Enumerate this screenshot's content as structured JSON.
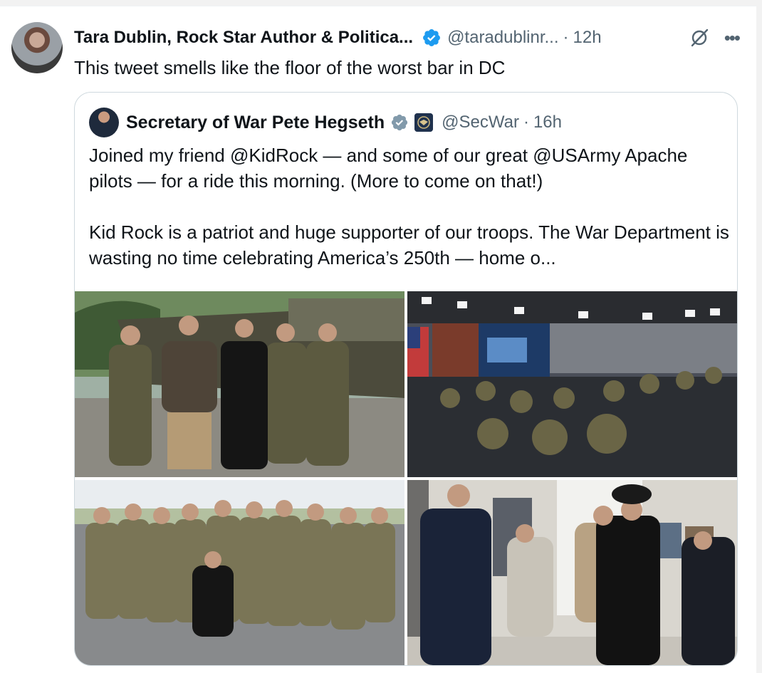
{
  "tweet": {
    "author_name": "Tara Dublin, Rock Star Author & Politica...",
    "handle": "@taradublinr...",
    "separator": "·",
    "time": "12h",
    "text": "This tweet smells like the floor of the worst bar in DC",
    "more_label": "•••"
  },
  "quoted_tweet": {
    "author_name": "Secretary of War Pete Hegseth",
    "handle": "@SecWar",
    "separator": "·",
    "time": "16h",
    "paragraph_1": "Joined my friend @KidRock — and some of our great @USArmy Apache pilots — for a ride this morning. (More to come on that!)",
    "paragraph_2": "Kid Rock is a patriot and huge supporter of our troops. The War Department is wasting no time celebrating America’s 250th — home o..."
  },
  "media": [
    {
      "icon": "photo-apache-group"
    },
    {
      "icon": "photo-briefing-room"
    },
    {
      "icon": "photo-soldiers-group"
    },
    {
      "icon": "photo-hallway"
    }
  ],
  "colors": {
    "verified_blue": "#1d9bf0",
    "muted_text": "#536471",
    "quote_border": "#cfd9de",
    "government_badge": "#829aab"
  }
}
